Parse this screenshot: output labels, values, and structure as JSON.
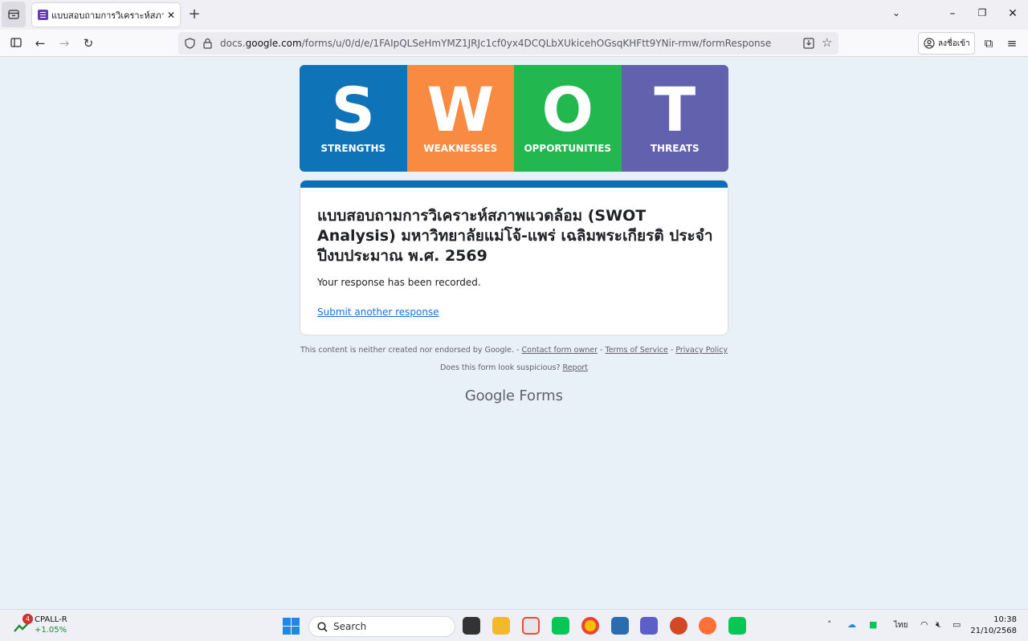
{
  "browser": {
    "tab_title": "แบบสอบถามการวิเคราะห์สภาพแว",
    "url_prefix": "docs.",
    "url_domain": "google.com",
    "url_path": "/forms/u/0/d/e/1FAIpQLSeHmYMZ1JRJc1cf0yx4DCQLbXUkicehOGsqKHFtt9YNir-rmw/formResponse",
    "signin_label": "ลงชื่อเข้า"
  },
  "banner": {
    "cells": [
      {
        "letter": "S",
        "word": "STRENGTHS",
        "color": "#0f73b7"
      },
      {
        "letter": "W",
        "word": "WEAKNESSES",
        "color": "#f98a42"
      },
      {
        "letter": "O",
        "word": "OPPORTUNITIES",
        "color": "#22b74f"
      },
      {
        "letter": "T",
        "word": "THREATS",
        "color": "#6261ae"
      }
    ]
  },
  "form": {
    "title": "แบบสอบถามการวิเคราะห์สภาพแวดล้อม (SWOT Analysis) มหาวิทยาลัยแม่โจ้-แพร่ เฉลิมพระเกียรติ ประจำปีงบประมาณ พ.ศ. 2569",
    "confirmation": "Your response has been recorded.",
    "another_link": "Submit another response",
    "accent_color": "#0f6fb4"
  },
  "footer": {
    "disclaimer": "This content is neither created nor endorsed by Google. -",
    "contact": "Contact form owner",
    "sep1": "-",
    "terms": "Terms of Service",
    "sep2": "-",
    "privacy": "Privacy Policy",
    "suspicious": "Does this form look suspicious?",
    "report": "Report",
    "brand_google": "Google",
    "brand_forms": "Forms"
  },
  "taskbar": {
    "stock_badge": "4",
    "stock_name": "CPALL-R",
    "stock_change": "+1.05%",
    "search_placeholder": "Search",
    "language": "ไทย",
    "time": "10:38",
    "date": "21/10/2568"
  }
}
